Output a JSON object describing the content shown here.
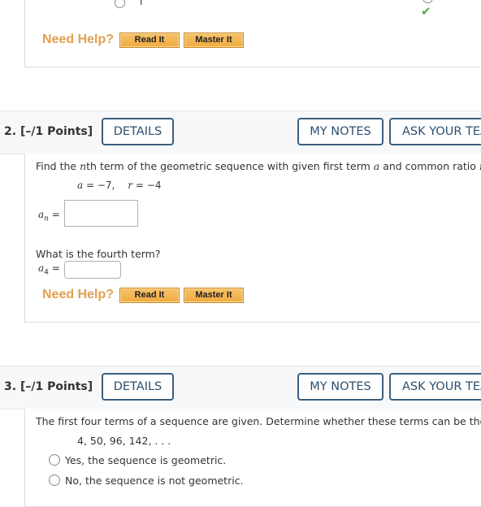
{
  "previous_question": {
    "partial_option_text": "l",
    "need_help_label": "Need Help?",
    "read_it_label": "Read It",
    "master_it_label": "Master It",
    "correct_mark": "✔"
  },
  "questions": [
    {
      "number": "2.",
      "points": "[–/1 Points]",
      "details_label": "DETAILS",
      "my_notes_label": "MY NOTES",
      "ask_teacher_label": "ASK YOUR TEA",
      "prompt": {
        "part1": "Find the ",
        "n": "n",
        "part2": "th term of the geometric sequence with given first term ",
        "a": "a",
        "part3": " and common ratio ",
        "r": "r",
        "part4": "."
      },
      "given": {
        "a_var": "a",
        "a_value": " = −7,",
        "r_var": "r",
        "r_value": " = −4"
      },
      "an_label_var": "a",
      "an_label_sub": "n",
      "equals": "=",
      "an_value": "",
      "sub_question": "What is the fourth term?",
      "a4_label_var": "a",
      "a4_label_sub": "4",
      "a4_value": "",
      "need_help_label": "Need Help?",
      "read_it_label": "Read It",
      "master_it_label": "Master It"
    },
    {
      "number": "3.",
      "points": "[–/1 Points]",
      "details_label": "DETAILS",
      "my_notes_label": "MY NOTES",
      "ask_teacher_label": "ASK YOUR TEA",
      "prompt": "The first four terms of a sequence are given. Determine whether these terms can be the ter",
      "sequence": "4, 50, 96, 142, . . .",
      "options": [
        "Yes, the sequence is geometric.",
        "No, the sequence is not geometric."
      ]
    }
  ]
}
